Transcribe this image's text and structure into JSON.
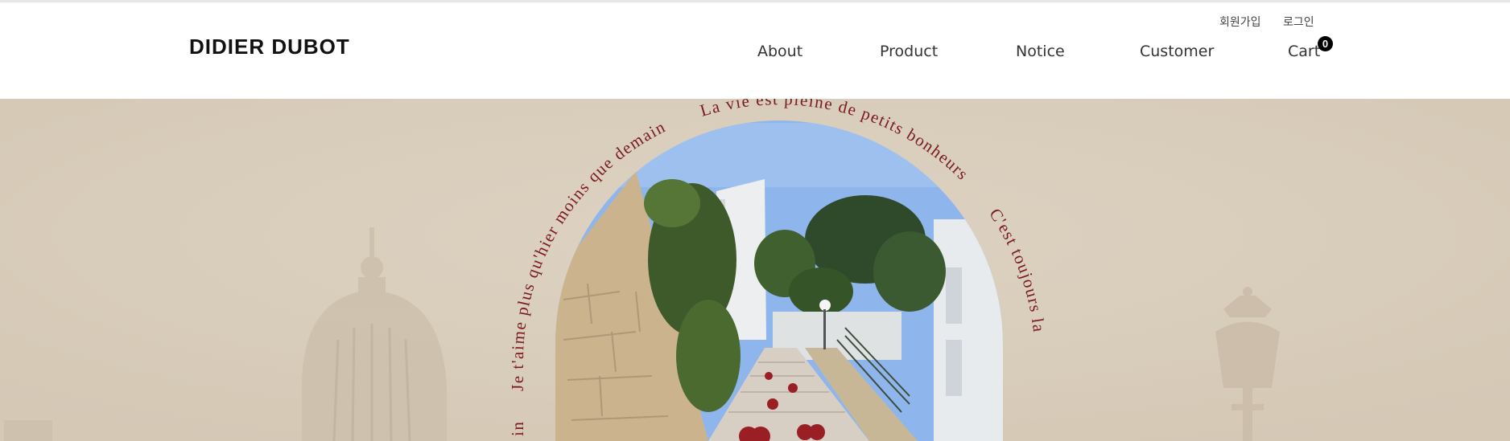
{
  "brand": {
    "logo": "DIDIER DUBOT"
  },
  "util_links": {
    "join": "회원가입",
    "login": "로그인"
  },
  "nav": {
    "about": "About",
    "product": "Product",
    "notice": "Notice",
    "customer": "Customer",
    "cart": "Cart",
    "cart_count": "0"
  },
  "hero": {
    "arc_text_1": "La vie est pleine de petits bonheurs",
    "arc_text_2": "C'est toujours la",
    "arc_text_3": "Je t'aime plus qu'hier moins que demain",
    "arc_text_4": "in"
  },
  "colors": {
    "hero_background": "#d9cdbc",
    "arc_text": "#7a1a1f",
    "sky": "#8fb6ec"
  }
}
